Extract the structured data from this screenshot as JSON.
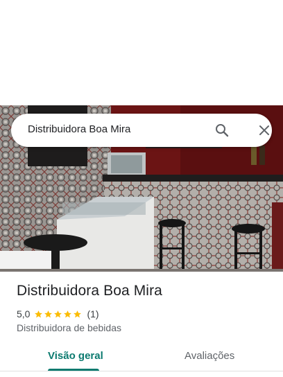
{
  "search": {
    "query": "Distribuidora Boa Mira",
    "search_icon": "search-icon",
    "close_icon": "close-icon"
  },
  "place": {
    "name": "Distribuidora Boa Mira",
    "rating": "5,0",
    "stars": 5,
    "review_count": "(1)",
    "category": "Distribuidora de bebidas",
    "star_color": "#fbbc04"
  },
  "tabs": [
    {
      "label": "Visão geral",
      "selected": true
    },
    {
      "label": "Avaliações",
      "selected": false
    }
  ],
  "colors": {
    "accent": "#0b7a6f"
  }
}
